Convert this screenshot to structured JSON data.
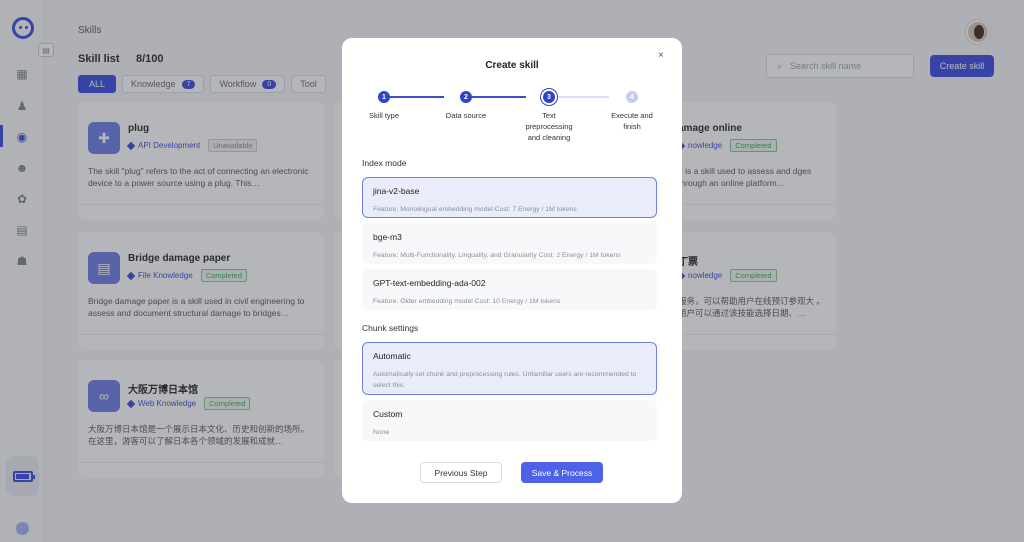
{
  "header": {
    "breadcrumb": "Skills",
    "title": "Skill list",
    "count": "8/100",
    "search_placeholder": "Search skill name",
    "create_label": "Create skill"
  },
  "filters": [
    {
      "label": "ALL",
      "badge": ""
    },
    {
      "label": "Knowledge",
      "badge": "7"
    },
    {
      "label": "Workflow",
      "badge": "0"
    },
    {
      "label": "Tool",
      "badge": ""
    }
  ],
  "sidebar": {
    "icons": [
      "dashboard-icon",
      "user-icon",
      "skills-icon",
      "team-icon",
      "settings-icon",
      "store-icon",
      "community-icon"
    ],
    "energy_level": 0.85
  },
  "cards": [
    {
      "name": "plug",
      "type": "API Development",
      "status": "Unavailable",
      "desc": "The skill \"plug\" refers to the act of connecting an electronic device to a power source using a plug. This…",
      "icon": "puzzle-icon",
      "status_kind": "na"
    },
    {
      "name": "Bridge damage paper",
      "type": "File Knowledge",
      "status": "Completed",
      "desc": "Bridge damage paper is a skill used in civil engineering to assess and document structural damage to bridges…",
      "icon": "file-icon",
      "status_kind": "ok"
    },
    {
      "name": "大阪万博日本馆",
      "type": "Web Knowledge",
      "status": "Completed",
      "desc": "大阪万博日本馆是一个展示日本文化、历史和创新的场所。在这里，游客可以了解日本各个领域的发展和成就…",
      "icon": "link-icon",
      "status_kind": "ok"
    },
    {
      "name": "amage online",
      "type": "nowledge",
      "status": "Completed",
      "desc": "e is a skill used to assess and dges through an online platform…",
      "icon": "",
      "status_kind": "ok"
    },
    {
      "name": "丁票",
      "type": "nowledge",
      "status": "Completed",
      "desc": "服务，可以帮助用户在线预订参观大 。用户可以通过该技能选择日期、…",
      "icon": "",
      "status_kind": "ok"
    }
  ],
  "modal": {
    "title": "Create skill",
    "close": "×",
    "steps": [
      {
        "num": "1",
        "label": "Skill type",
        "state": "done"
      },
      {
        "num": "2",
        "label": "Data source",
        "state": "done"
      },
      {
        "num": "3",
        "label": "Text preprocessing and cleaning",
        "state": "current"
      },
      {
        "num": "4",
        "label": "Execute and finish",
        "state": "todo"
      }
    ],
    "index_mode_label": "Index mode",
    "index_options": [
      {
        "name": "jina-v2-base",
        "desc": "Feature: Monolingual embedding model Cost: 7 Energy / 1M tokens",
        "selected": true
      },
      {
        "name": "bge-m3",
        "desc": "Feature: Multi-Functionality, Linguality, and Granularity Cost: 2 Energy / 1M tokens",
        "selected": false
      },
      {
        "name": "GPT-text-embedding-ada-002",
        "desc": "Feature: Older embedding model Cost: 10 Energy / 1M tokens",
        "selected": false
      }
    ],
    "chunk_label": "Chunk settings",
    "chunk_options": [
      {
        "name": "Automatic",
        "desc": "Automatically set chunk and preprocessing rules. Unfamiliar users are recommended to select this.",
        "selected": true
      },
      {
        "name": "Custom",
        "desc": "None",
        "selected": false
      }
    ],
    "prev_label": "Previous Step",
    "save_label": "Save & Process"
  },
  "colors": {
    "accent": "#3548e0",
    "completed": "#3aa657"
  }
}
